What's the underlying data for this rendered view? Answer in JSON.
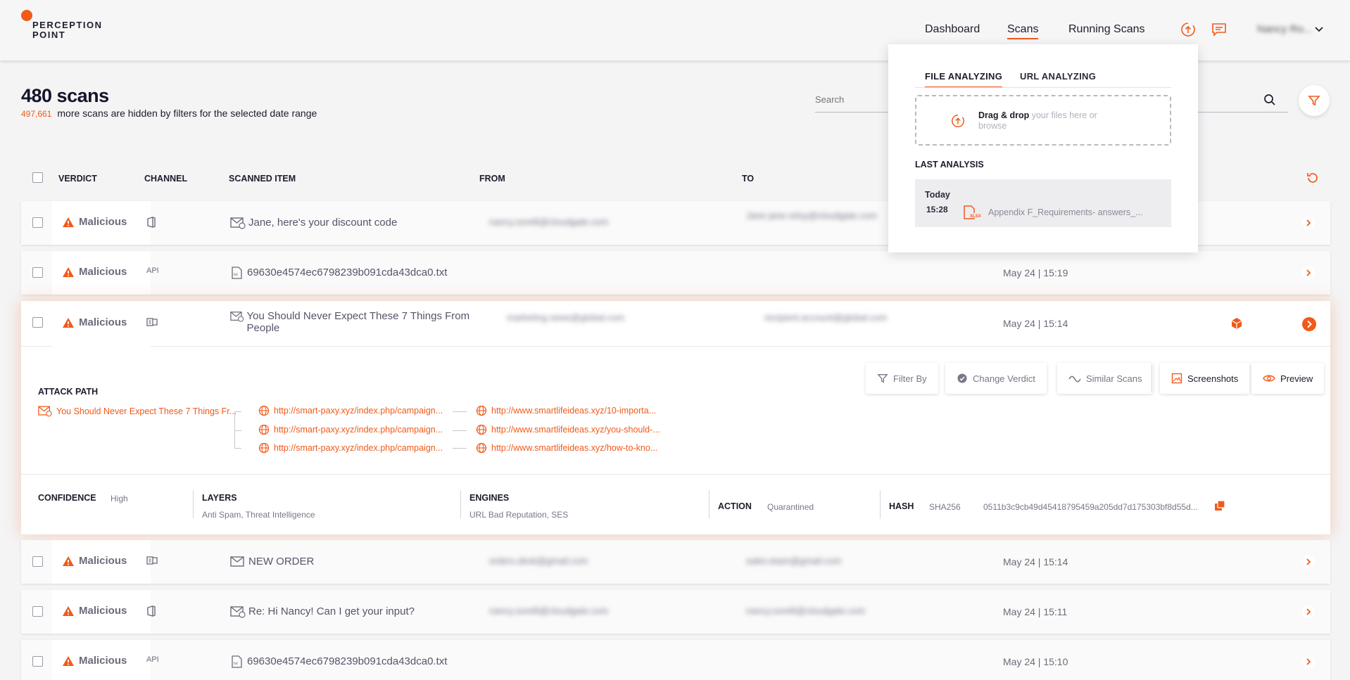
{
  "brand": {
    "line1": "PERCEPTION",
    "line2": "POINT"
  },
  "nav": {
    "dashboard": "Dashboard",
    "scans": "Scans",
    "running": "Running Scans"
  },
  "user": {
    "name": "Nancy Ro..."
  },
  "page": {
    "title": "480 scans",
    "hidden_count": "497,661",
    "hidden_text": "more scans are hidden by filters for the selected date range"
  },
  "search": {
    "placeholder": "Search"
  },
  "table": {
    "headers": {
      "verdict": "VERDICT",
      "channel": "CHANNEL",
      "item": "SCANNED ITEM",
      "from": "FROM",
      "to": "TO"
    }
  },
  "rows": [
    {
      "verdict": "Malicious",
      "channel": "",
      "item": "Jane, here's your discount code",
      "from": "nancy.sorelli@cloudgate.com",
      "to": "Jane jane.reloy@cloudgate.com",
      "date": ""
    },
    {
      "verdict": "Malicious",
      "channel": "API",
      "item": "69630e4574ec6798239b091cda43dca0.txt",
      "from": "",
      "to": "",
      "date": "May 24 | 15:19"
    },
    {
      "verdict": "Malicious",
      "channel": "",
      "item": "You Should Never Expect These 7 Things From People",
      "from": "marketing.news@global.com",
      "to": "recipient.account@global.com",
      "date": "May 24 | 15:14"
    },
    {
      "verdict": "Malicious",
      "channel": "",
      "item": "NEW ORDER",
      "from": "orders.desk@gmail.com",
      "to": "sales.team@gmail.com",
      "date": "May 24 | 15:14"
    },
    {
      "verdict": "Malicious",
      "channel": "",
      "item": "Re: Hi Nancy! Can I get your input?",
      "from": "nancy.sorelli@cloudgate.com",
      "to": "nancy.sorelli@cloudgate.com",
      "date": "May 24 | 15:11"
    },
    {
      "verdict": "Malicious",
      "channel": "API",
      "item": "69630e4574ec6798239b091cda43dca0.txt",
      "from": "",
      "to": "",
      "date": "May 24 | 15:10"
    }
  ],
  "detail": {
    "attack_path_title": "ATTACK PATH",
    "root": "You Should Never Expect These 7 Things Fr...",
    "level1": [
      "http://smart-paxy.xyz/index.php/campaign...",
      "http://smart-paxy.xyz/index.php/campaign...",
      "http://smart-paxy.xyz/index.php/campaign..."
    ],
    "level2": [
      "http://www.smartlifeideas.xyz/10-importa...",
      "http://www.smartlifeideas.xyz/you-should-...",
      "http://www.smartlifeideas.xyz/how-to-kno..."
    ],
    "actions": {
      "filter_by": "Filter By",
      "change_verdict": "Change Verdict",
      "similar": "Similar Scans",
      "screenshots": "Screenshots",
      "preview": "Preview"
    },
    "meta": {
      "confidence_k": "CONFIDENCE",
      "confidence_v": "High",
      "layers_k": "LAYERS",
      "layers_v": "Anti Spam, Threat Intelligence",
      "engines_k": "ENGINES",
      "engines_v": "URL Bad Reputation, SES",
      "action_k": "ACTION",
      "action_v": "Quarantined",
      "hash_k": "HASH",
      "hash_type": "SHA256",
      "hash_v": "0511b3c9cb49d45418795459a205dd7d175303bf8d55d..."
    }
  },
  "popover": {
    "tab_file": "FILE ANALYZING",
    "tab_url": "URL ANALYZING",
    "drag_bold": "Drag & drop",
    "drag_rest": "your files here or browse",
    "last_title": "LAST ANALYSIS",
    "last_day": "Today",
    "last_time": "15:28",
    "last_file": "Appendix F_Requirements- answers_...",
    "file_badge": "XLSX"
  },
  "colors": {
    "accent": "#f05a1a",
    "text": "#1c1c2c",
    "muted": "#77778a"
  }
}
